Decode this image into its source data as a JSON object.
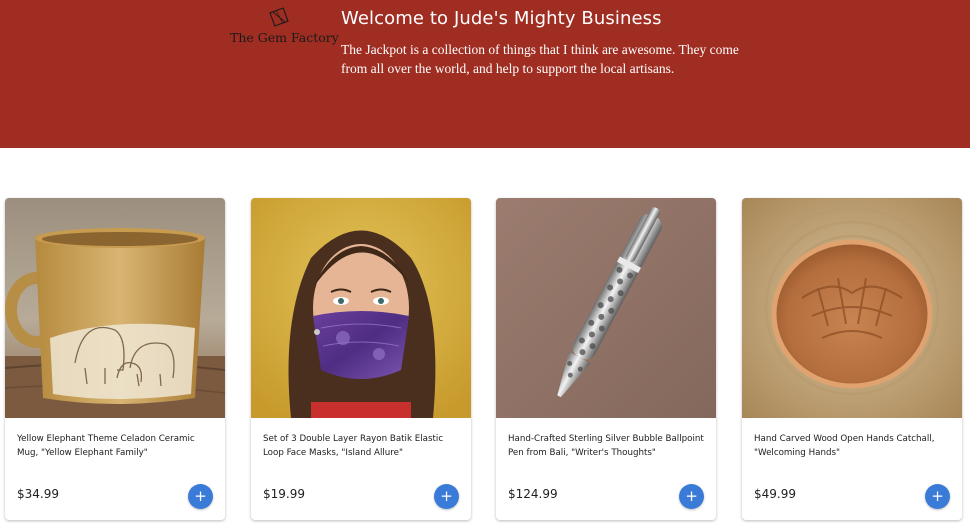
{
  "header": {
    "logo_text": "The Gem Factory",
    "title": "Welcome to Jude's Mighty Business",
    "description": "The Jackpot is a collection of things that I think are awesome. They come from all over the world, and help to support the local artisans."
  },
  "products": [
    {
      "title": "Yellow Elephant Theme Celadon Ceramic Mug, \"Yellow Elephant Family\"",
      "price": "$34.99",
      "add_label": "+",
      "image": "ceramic-mug-photo"
    },
    {
      "title": "Set of 3 Double Layer Rayon Batik Elastic Loop Face Masks, \"Island Allure\"",
      "price": "$19.99",
      "add_label": "+",
      "image": "face-mask-photo"
    },
    {
      "title": "Hand-Crafted Sterling Silver Bubble Ballpoint Pen from Bali, \"Writer's Thoughts\"",
      "price": "$124.99",
      "add_label": "+",
      "image": "silver-pen-photo"
    },
    {
      "title": "Hand Carved Wood Open Hands Catchall, \"Welcoming Hands\"",
      "price": "$49.99",
      "add_label": "+",
      "image": "wood-bowl-photo"
    }
  ],
  "colors": {
    "header_bg": "#a02d22",
    "button": "#3b7bd8"
  }
}
